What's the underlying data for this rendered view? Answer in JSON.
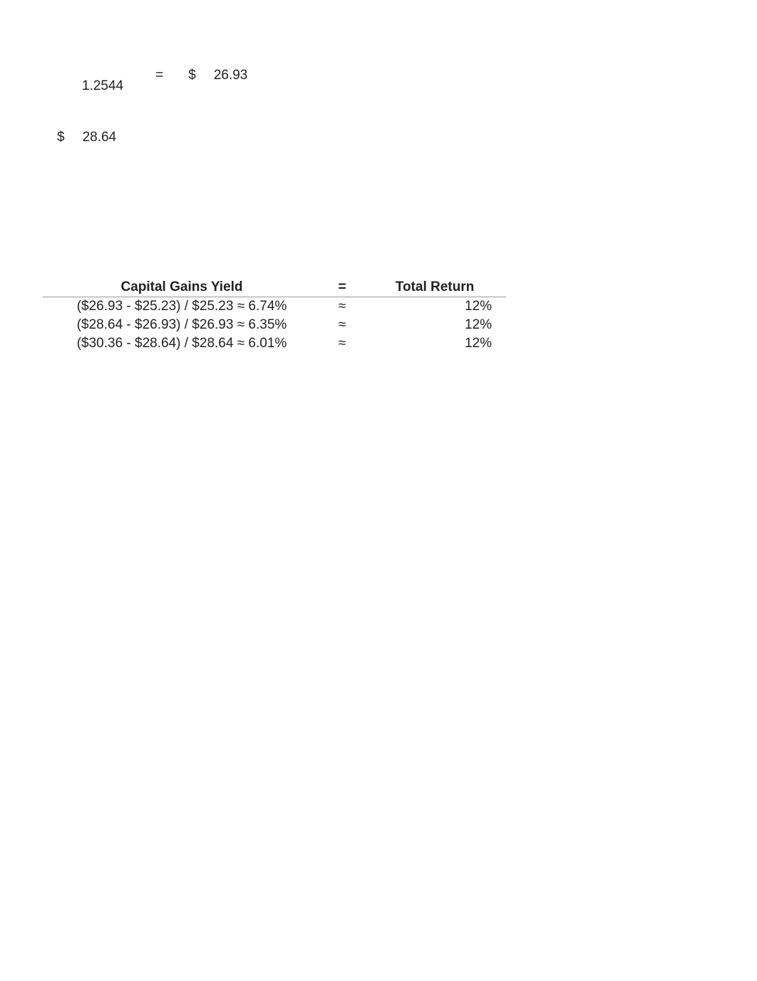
{
  "top": {
    "divisor": "1.2544",
    "equals": "=",
    "currency1": "$",
    "amount1": "26.93",
    "currency2": "$",
    "amount2": "28.64"
  },
  "table": {
    "headers": {
      "col1": "Capital Gains Yield",
      "col2": "=",
      "col3": "Total Return"
    },
    "rows": [
      {
        "calc": "($26.93 - $25.23) / $25.23 ≈ 6.74%",
        "approx": "≈",
        "total": "12%"
      },
      {
        "calc": "($28.64 - $26.93) / $26.93 ≈ 6.35%",
        "approx": "≈",
        "total": "12%"
      },
      {
        "calc": "($30.36 - $28.64) / $28.64 ≈ 6.01%",
        "approx": "≈",
        "total": "12%"
      }
    ]
  }
}
